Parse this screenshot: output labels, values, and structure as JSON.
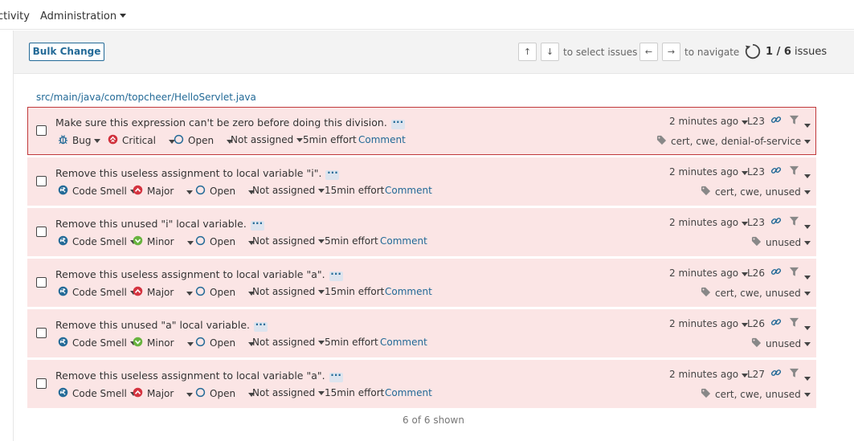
{
  "nav": {
    "activity_label": "ctivity",
    "admin_label": "Administration"
  },
  "toolbar": {
    "bulk_label": "Bulk Change",
    "up_key": "↑",
    "down_key": "↓",
    "select_text": "to select issues",
    "left_key": "←",
    "right_key": "→",
    "navigate_text": "to navigate",
    "page_current": "1 / 6",
    "page_suffix": " issues"
  },
  "file_path": "src/main/java/com/topcheer/HelloServlet.java",
  "colors": {
    "accent": "#236a97",
    "issue_bg": "#fbe5e5",
    "selected_border": "#c0393b",
    "bug_red": "#d02f3a",
    "minor_green": "#68b33e",
    "major_red": "#d4333f"
  },
  "issues": [
    {
      "message": "Make sure this expression can't be zero before doing this division.",
      "type": "Bug",
      "type_icon": "bug-icon",
      "severity": "Critical",
      "severity_icon": "critical-icon",
      "status": "Open",
      "assignee": "Not assigned",
      "effort": "5min effort",
      "comment": "Comment",
      "time": "2 minutes ago",
      "line": "L23",
      "tags": "cert, cwe, denial-of-service",
      "selected": true
    },
    {
      "message": "Remove this useless assignment to local variable \"i\".",
      "type": "Code Smell",
      "type_icon": "code-smell-icon",
      "severity": "Major",
      "severity_icon": "major-icon",
      "status": "Open",
      "assignee": "Not assigned",
      "effort": "15min effort",
      "comment": "Comment",
      "time": "2 minutes ago",
      "line": "L23",
      "tags": "cert, cwe, unused",
      "selected": false
    },
    {
      "message": "Remove this unused \"i\" local variable.",
      "type": "Code Smell",
      "type_icon": "code-smell-icon",
      "severity": "Minor",
      "severity_icon": "minor-icon",
      "status": "Open",
      "assignee": "Not assigned",
      "effort": "5min effort",
      "comment": "Comment",
      "time": "2 minutes ago",
      "line": "L23",
      "tags": "unused",
      "selected": false
    },
    {
      "message": "Remove this useless assignment to local variable \"a\".",
      "type": "Code Smell",
      "type_icon": "code-smell-icon",
      "severity": "Major",
      "severity_icon": "major-icon",
      "status": "Open",
      "assignee": "Not assigned",
      "effort": "15min effort",
      "comment": "Comment",
      "time": "2 minutes ago",
      "line": "L26",
      "tags": "cert, cwe, unused",
      "selected": false
    },
    {
      "message": "Remove this unused \"a\" local variable.",
      "type": "Code Smell",
      "type_icon": "code-smell-icon",
      "severity": "Minor",
      "severity_icon": "minor-icon",
      "status": "Open",
      "assignee": "Not assigned",
      "effort": "5min effort",
      "comment": "Comment",
      "time": "2 minutes ago",
      "line": "L26",
      "tags": "unused",
      "selected": false
    },
    {
      "message": "Remove this useless assignment to local variable \"a\".",
      "type": "Code Smell",
      "type_icon": "code-smell-icon",
      "severity": "Major",
      "severity_icon": "major-icon",
      "status": "Open",
      "assignee": "Not assigned",
      "effort": "15min effort",
      "comment": "Comment",
      "time": "2 minutes ago",
      "line": "L27",
      "tags": "cert, cwe, unused",
      "selected": false
    }
  ],
  "footer": {
    "shown_text": "6 of 6 shown"
  }
}
